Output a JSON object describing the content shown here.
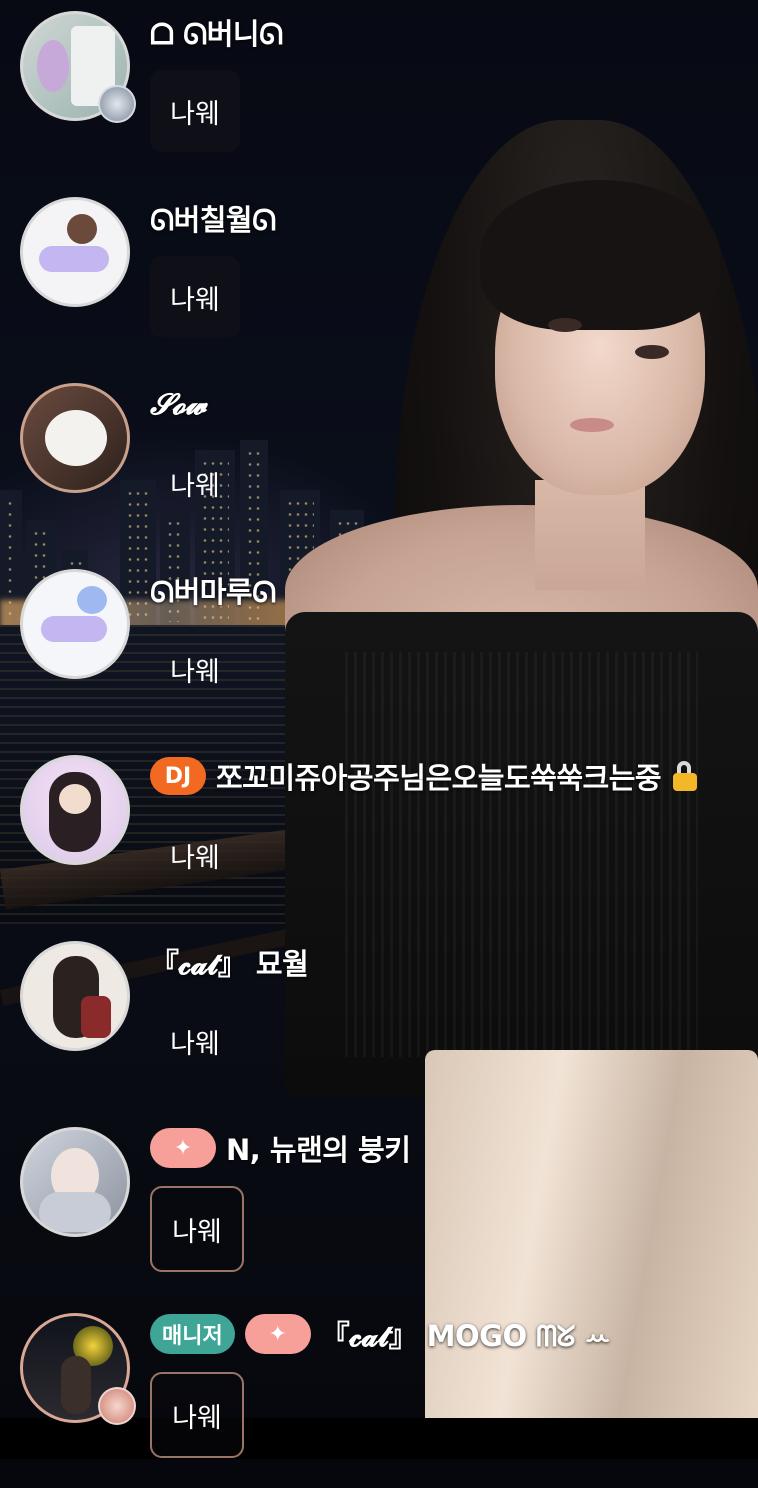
{
  "messages": [
    {
      "name": "ᗝ ᘏ버니ᘏ",
      "text": "나웨",
      "badges": [],
      "style": "dark"
    },
    {
      "name": "ᘏ버칠월ᘏ",
      "text": "나웨",
      "badges": [],
      "style": "dark"
    },
    {
      "name": "𝓢𝓸𝔀",
      "text": "나웨",
      "badges": [],
      "style": "clear"
    },
    {
      "name": "ᘏ버마루ᘏ",
      "text": "나웨",
      "badges": [],
      "style": "clear"
    },
    {
      "name": "쪼꼬미쥬아공주님은오늘도쑥쑥크는중",
      "text": "나웨",
      "badge_dj": "DJ",
      "style": "clear"
    },
    {
      "name": "『𝓬𝓪𝓽』 묘월",
      "text": "나웨",
      "badges": [],
      "style": "clear"
    },
    {
      "name": "N, 뉴랜의 붕키",
      "text": "나웨",
      "badge_star": "✦",
      "style": "outline"
    },
    {
      "name": "『𝓬𝓪𝓽』 MOGO ᗰᘜ ꕀ",
      "text": "나웨",
      "badge_manager": "매니저",
      "badge_star": "✦",
      "style": "outline"
    }
  ],
  "colors": {
    "dj_badge": "#f26a21",
    "star_badge": "#f7a09a",
    "manager_badge": "#3fa597",
    "lock": "#f3b828"
  },
  "icons": [
    "lock-icon",
    "sparkle-icon"
  ]
}
